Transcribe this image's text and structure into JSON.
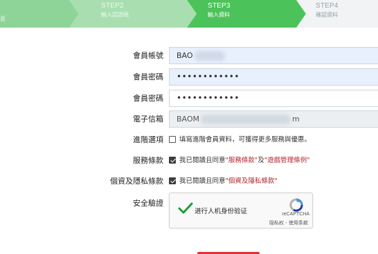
{
  "steps": {
    "step1": {
      "subtitle": "意"
    },
    "step2": {
      "title": "STEP2",
      "subtitle": "輸入認證碼"
    },
    "step3": {
      "title": "STEP3",
      "subtitle": "輸入資料"
    },
    "step4": {
      "title": "STEP4",
      "subtitle": "確認資料"
    }
  },
  "form": {
    "account": {
      "label": "會員帳號",
      "value": "BAO"
    },
    "password": {
      "label": "會員密碼",
      "value": "••••••••••••"
    },
    "password_confirm": {
      "label": "會員密碼",
      "value": "••••••••••••"
    },
    "email": {
      "label": "電子信箱",
      "value_start": "BAOM",
      "value_end": "m"
    },
    "advanced": {
      "label": "進階選項",
      "text": "填寫進階會員資料，可獲得更多服務與優惠。",
      "checked": false
    },
    "terms": {
      "label": "服務條款",
      "prefix": "我已閱讀且同意",
      "link1": "\"服務條款\"",
      "middle": "及",
      "link2": "\"遊戲管理條例\"",
      "checked": true
    },
    "privacy": {
      "label": "個資及隱私條款",
      "prefix": "我已閱讀且同意",
      "link": "\"個資及隱私條款\"",
      "checked": true
    },
    "security": {
      "label": "安全驗證"
    }
  },
  "captcha": {
    "text": "进行人机身份验证",
    "brand": "reCAPTCHA",
    "links": "隐私权 - 使用条款"
  },
  "colors": {
    "step_active": "#4cc35a",
    "step_done": "#8ed498",
    "step_inactive": "#f1f3f4",
    "link_red": "#b3252b",
    "autofill_bg": "#e8f0fe"
  }
}
